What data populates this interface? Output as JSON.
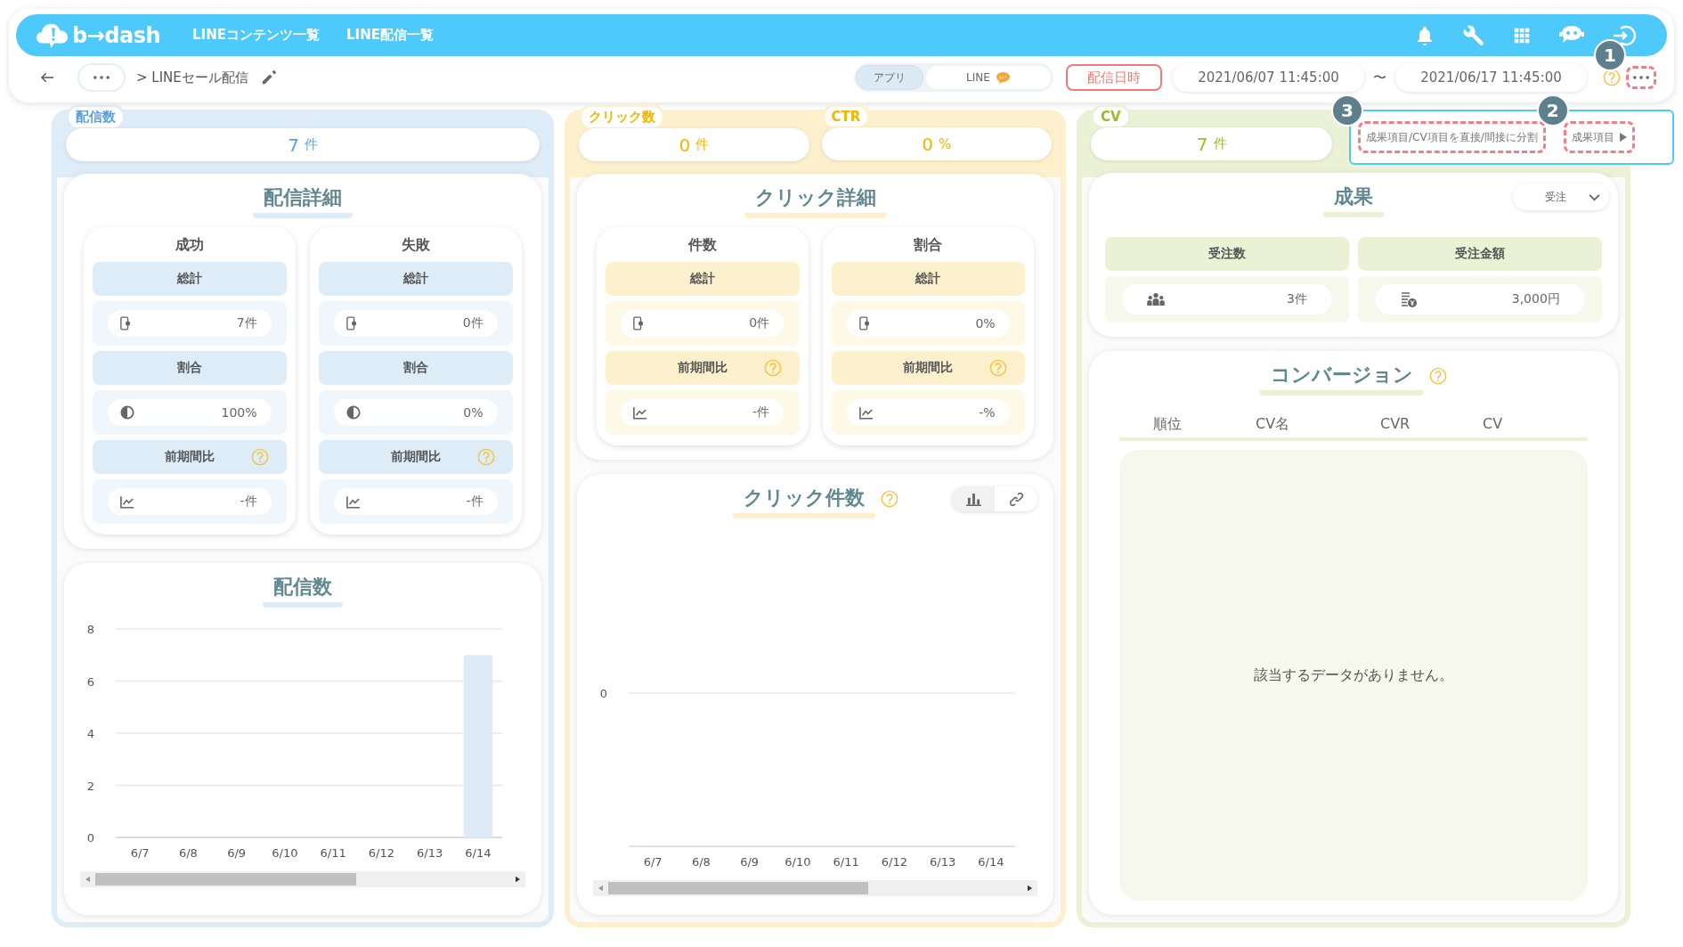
{
  "header": {
    "logo": "b→dash",
    "nav": [
      {
        "label": "LINEコンテンツ一覧"
      },
      {
        "label": "LINE配信一覧"
      }
    ]
  },
  "toolbar": {
    "breadcrumb": "> LINEセール配信",
    "channels": [
      {
        "label": "アプリ",
        "selected": true
      },
      {
        "label": "LINE",
        "selected": false
      }
    ],
    "date_label": "配信日時",
    "date_from": "2021/06/07 11:45:00",
    "separator": "〜",
    "date_to": "2021/06/17 11:45:00",
    "more": {
      "highlighted": true,
      "callout": "1"
    }
  },
  "menu": {
    "items": [
      {
        "label": "成果項目/CV項目を直接/間接に分割",
        "submenu": false,
        "highlighted": true,
        "callout": "3"
      },
      {
        "label": "成果項目",
        "submenu": true,
        "highlighted": true,
        "callout": "2"
      }
    ]
  },
  "sections": [
    {
      "color": "#5aa0dc",
      "metrics": [
        {
          "label": "配信数",
          "value": "7",
          "unit": "件"
        }
      ],
      "cards": [
        {
          "kind": "detail",
          "title": "配信詳細",
          "groups": [
            {
              "title": "成功",
              "rows": [
                {
                  "label": "総計",
                  "kind": "total",
                  "help": false,
                  "value": "7件"
                },
                {
                  "label": "割合",
                  "kind": "ratio",
                  "help": false,
                  "value": "100%"
                },
                {
                  "label": "前期間比",
                  "kind": "change",
                  "help": true,
                  "value": "-件"
                }
              ]
            },
            {
              "title": "失敗",
              "rows": [
                {
                  "label": "総計",
                  "kind": "total",
                  "help": false,
                  "value": "0件"
                },
                {
                  "label": "割合",
                  "kind": "ratio",
                  "help": false,
                  "value": "0%"
                },
                {
                  "label": "前期間比",
                  "kind": "change",
                  "help": true,
                  "value": "-件"
                }
              ]
            }
          ]
        },
        {
          "kind": "chart",
          "title": "配信数",
          "help": false,
          "chart_data": {
            "type": "bar",
            "categories": [
              "6/7",
              "6/8",
              "6/9",
              "6/10",
              "6/11",
              "6/12",
              "6/13",
              "6/14"
            ],
            "values": [
              0,
              0,
              0,
              0,
              0,
              0,
              0,
              7
            ],
            "ylim": [
              0,
              8
            ],
            "yticks": [
              0,
              2,
              4,
              6,
              8
            ],
            "grid": true
          }
        }
      ]
    },
    {
      "color": "#f4b400",
      "metrics": [
        {
          "label": "クリック数",
          "value": "0",
          "unit": "件"
        },
        {
          "label": "CTR",
          "value": "0",
          "unit": "%"
        }
      ],
      "cards": [
        {
          "kind": "detail",
          "title": "クリック詳細",
          "groups": [
            {
              "title": "件数",
              "rows": [
                {
                  "label": "総計",
                  "kind": "total",
                  "help": false,
                  "value": "0件"
                },
                {
                  "label": "前期間比",
                  "kind": "change",
                  "help": true,
                  "value": "-件"
                }
              ]
            },
            {
              "title": "割合",
              "rows": [
                {
                  "label": "総計",
                  "kind": "total",
                  "help": false,
                  "value": "0%"
                },
                {
                  "label": "前期間比",
                  "kind": "change",
                  "help": true,
                  "value": "-%"
                }
              ]
            }
          ]
        },
        {
          "kind": "chart",
          "title": "クリック件数",
          "help": true,
          "tools": [
            {
              "kind": "bar",
              "selected": true
            },
            {
              "kind": "link",
              "selected": false
            }
          ],
          "chart_data": {
            "type": "other",
            "categories": [
              "6/7",
              "6/8",
              "6/9",
              "6/10",
              "6/11",
              "6/12",
              "6/13",
              "6/14"
            ],
            "annotations": [
              {
                "text": "0"
              }
            ]
          }
        }
      ]
    },
    {
      "color": "#9bbb2a",
      "metrics": [
        {
          "label": "CV",
          "value": "7",
          "unit": "件"
        }
      ],
      "cards": [
        {
          "kind": "results",
          "title": "成果",
          "dropdown": "受注",
          "tiles": [
            {
              "label": "受注数",
              "kind": "people",
              "value": "3件"
            },
            {
              "label": "受注金額",
              "kind": "coins",
              "value": "3,000円"
            }
          ]
        },
        {
          "kind": "table",
          "title": "コンバージョン",
          "help": true,
          "columns": [
            "順位",
            "CV名",
            "CVR",
            "CV"
          ],
          "empty": "該当するデータがありません。"
        }
      ]
    }
  ]
}
